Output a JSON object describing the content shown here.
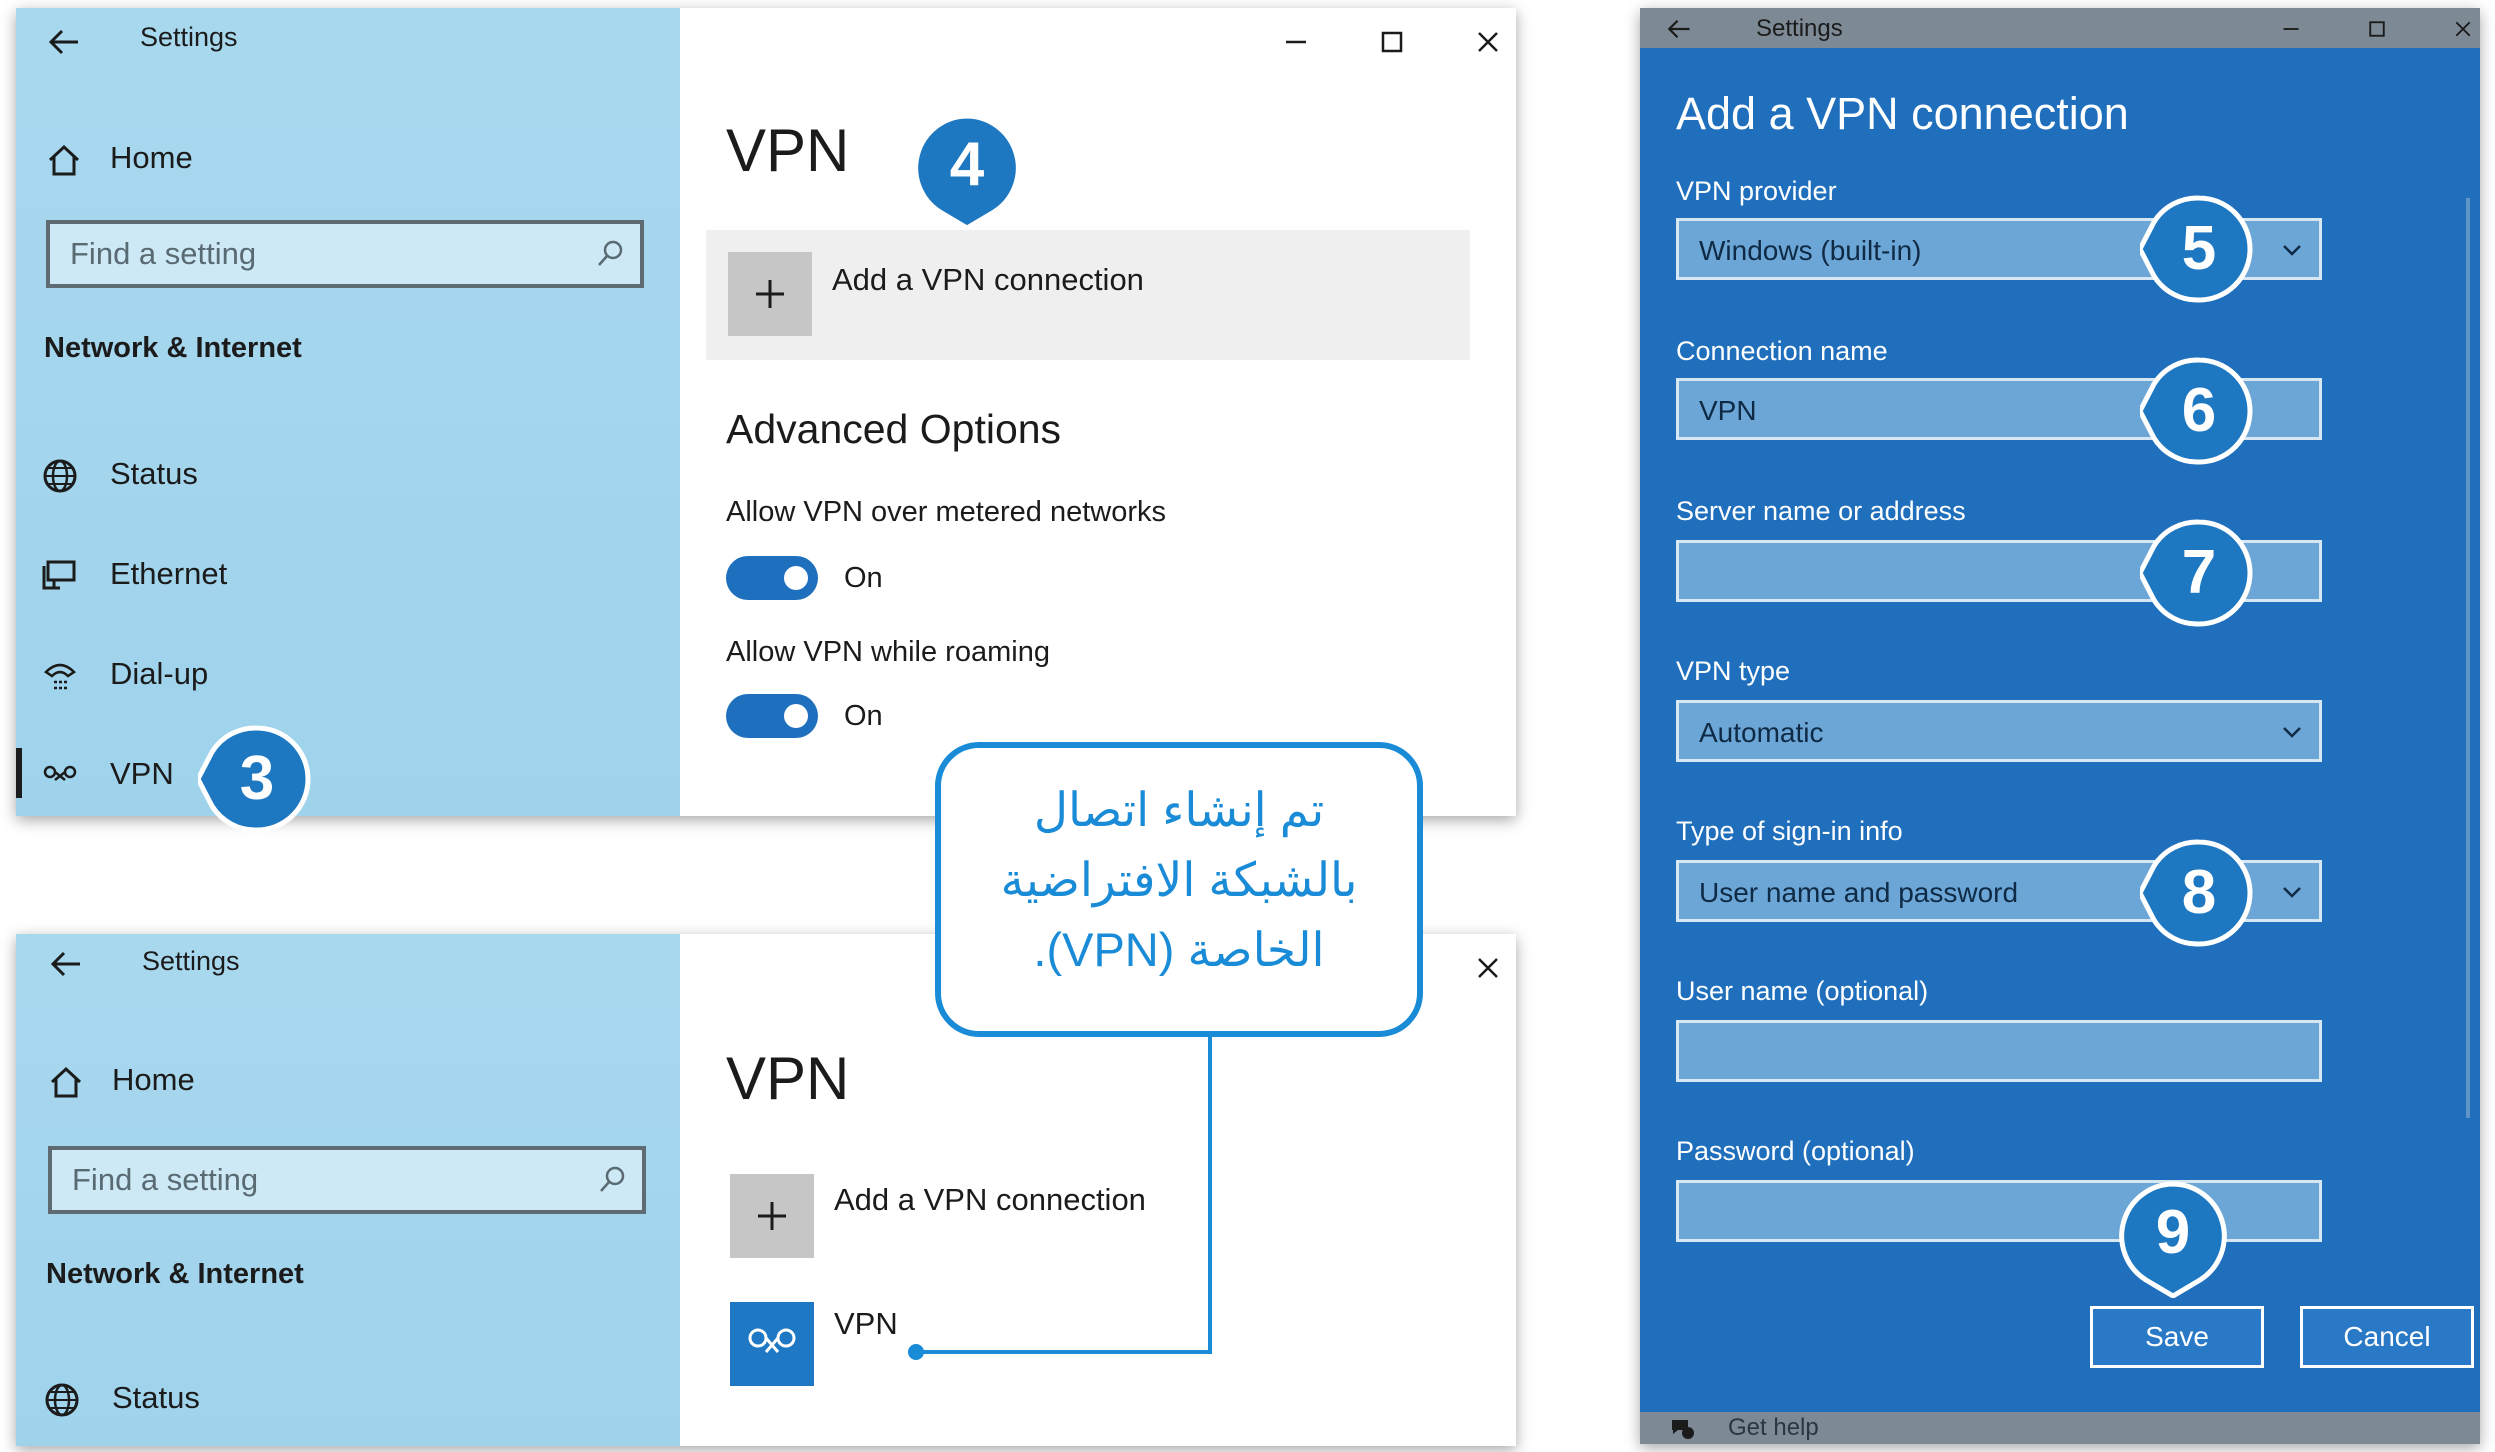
{
  "top_window": {
    "title": "Settings",
    "sidebar": {
      "home_label": "Home",
      "search_placeholder": "Find a setting",
      "section_title": "Network & Internet",
      "items": [
        {
          "label": "Status",
          "icon": "globe-icon"
        },
        {
          "label": "Ethernet",
          "icon": "ethernet-icon"
        },
        {
          "label": "Dial-up",
          "icon": "dialup-icon"
        },
        {
          "label": "VPN",
          "icon": "vpn-icon"
        }
      ]
    },
    "main": {
      "title": "VPN",
      "add_label": "Add a VPN connection",
      "advanced_title": "Advanced Options",
      "option1_label": "Allow VPN over metered networks",
      "option1_state": "On",
      "option2_label": "Allow VPN while roaming",
      "option2_state": "On"
    }
  },
  "bottom_window": {
    "title": "Settings",
    "sidebar": {
      "home_label": "Home",
      "search_placeholder": "Find a setting",
      "section_title": "Network & Internet",
      "items": [
        {
          "label": "Status",
          "icon": "globe-icon"
        }
      ]
    },
    "main": {
      "title": "VPN",
      "add_label": "Add a VPN connection",
      "connection_label": "VPN"
    }
  },
  "dialog": {
    "titlebar": "Settings",
    "heading": "Add a VPN connection",
    "vpn_provider_label": "VPN provider",
    "vpn_provider_value": "Windows (built-in)",
    "connection_name_label": "Connection name",
    "connection_name_value": "VPN",
    "server_label": "Server name or address",
    "server_value": "",
    "vpn_type_label": "VPN type",
    "vpn_type_value": "Automatic",
    "signin_label": "Type of sign-in info",
    "signin_value": "User name and password",
    "username_label": "User name (optional)",
    "password_label": "Password (optional)",
    "save_label": "Save",
    "cancel_label": "Cancel",
    "help_label": "Get help"
  },
  "callouts": {
    "step3": "3",
    "step4": "4",
    "step5": "5",
    "step6": "6",
    "step7": "7",
    "step8": "8",
    "step9": "9"
  },
  "note": {
    "line1": "تم إنشاء اتصال",
    "line2": "بالشبكة الافتراضية",
    "line3": "الخاصة (VPN)."
  },
  "colors": {
    "accent": "#1a8bd6",
    "callout_fill": "#1d78c1",
    "sidebar_bg": "#a8d8ee",
    "dialog_bg": "#1f6fbd",
    "toggle_on": "#1f6fbf"
  }
}
